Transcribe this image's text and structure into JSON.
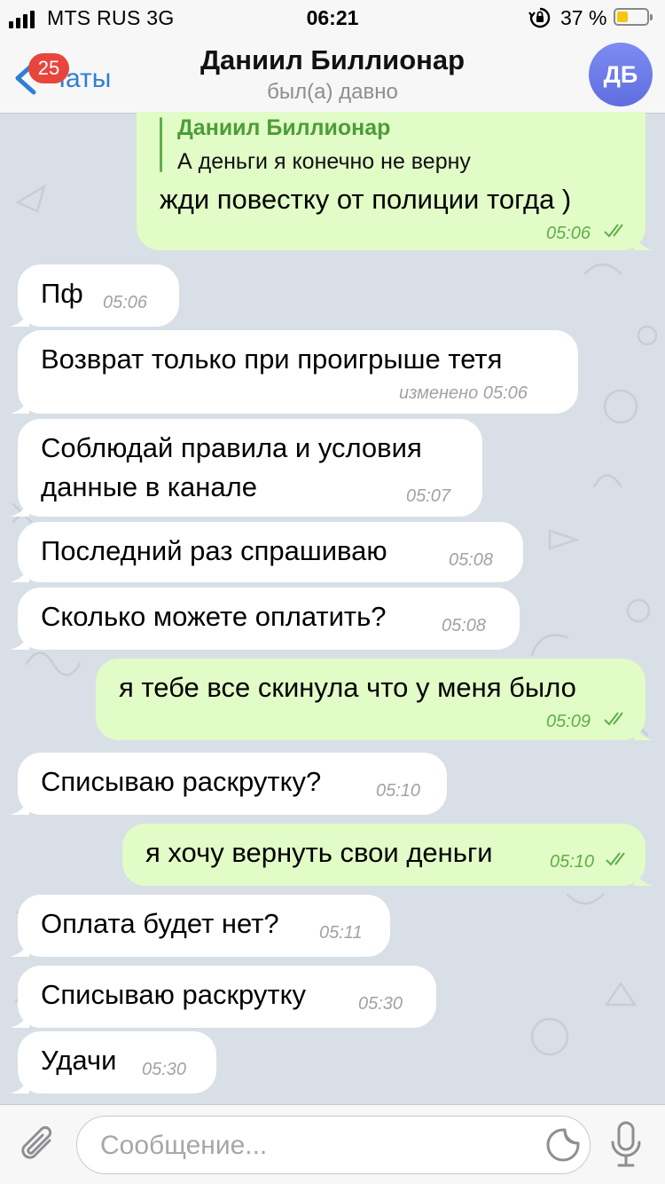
{
  "status_bar": {
    "carrier": "MTS RUS  3G",
    "time": "06:21",
    "battery_percent_label": "37 %",
    "battery_level": 0.37,
    "icons": [
      "signal-icon",
      "orientation-lock-icon",
      "battery-icon"
    ]
  },
  "header": {
    "back_label": "Чаты",
    "unread_badge": "25",
    "title": "Даниил Биллионар",
    "subtitle": "был(а) давно",
    "avatar_initials": "ДБ",
    "avatar_color": "#6b7be8"
  },
  "messages": [
    {
      "direction": "out",
      "reply_to_name": "Даниил Биллионар",
      "reply_to_text": "А деньги я конечно не верну",
      "text": "жди повестку от полиции тогда )",
      "time": "05:06",
      "read": true
    },
    {
      "direction": "in",
      "text": "Пф",
      "time": "05:06"
    },
    {
      "direction": "in",
      "text": "Возврат только при проигрыше тетя",
      "time": "изменено 05:06"
    },
    {
      "direction": "in",
      "text_line1": "Соблюдай правила и условия",
      "text_line2": "данные в канале",
      "time": "05:07"
    },
    {
      "direction": "in",
      "text": "Последний раз спрашиваю",
      "time": "05:08"
    },
    {
      "direction": "in",
      "text": "Сколько можете оплатить?",
      "time": "05:08"
    },
    {
      "direction": "out",
      "text": "я тебе все скинула что у меня было",
      "time": "05:09",
      "read": true
    },
    {
      "direction": "in",
      "text": "Списываю раскрутку?",
      "time": "05:10"
    },
    {
      "direction": "out",
      "text": "я хочу вернуть свои деньги",
      "time": "05:10",
      "read": true
    },
    {
      "direction": "in",
      "text": "Оплата будет нет?",
      "time": "05:11"
    },
    {
      "direction": "in",
      "text": "Списываю раскрутку",
      "time": "05:30"
    },
    {
      "direction": "in",
      "text": "Удачи",
      "time": "05:30"
    }
  ],
  "input_bar": {
    "placeholder": "Сообщение...",
    "value": ""
  },
  "colors": {
    "outgoing_bubble": "#e1fcc7",
    "incoming_bubble": "#ffffff",
    "accent": "#2f7fd3",
    "read_check": "#5fae4a",
    "badge": "#e8453c"
  }
}
